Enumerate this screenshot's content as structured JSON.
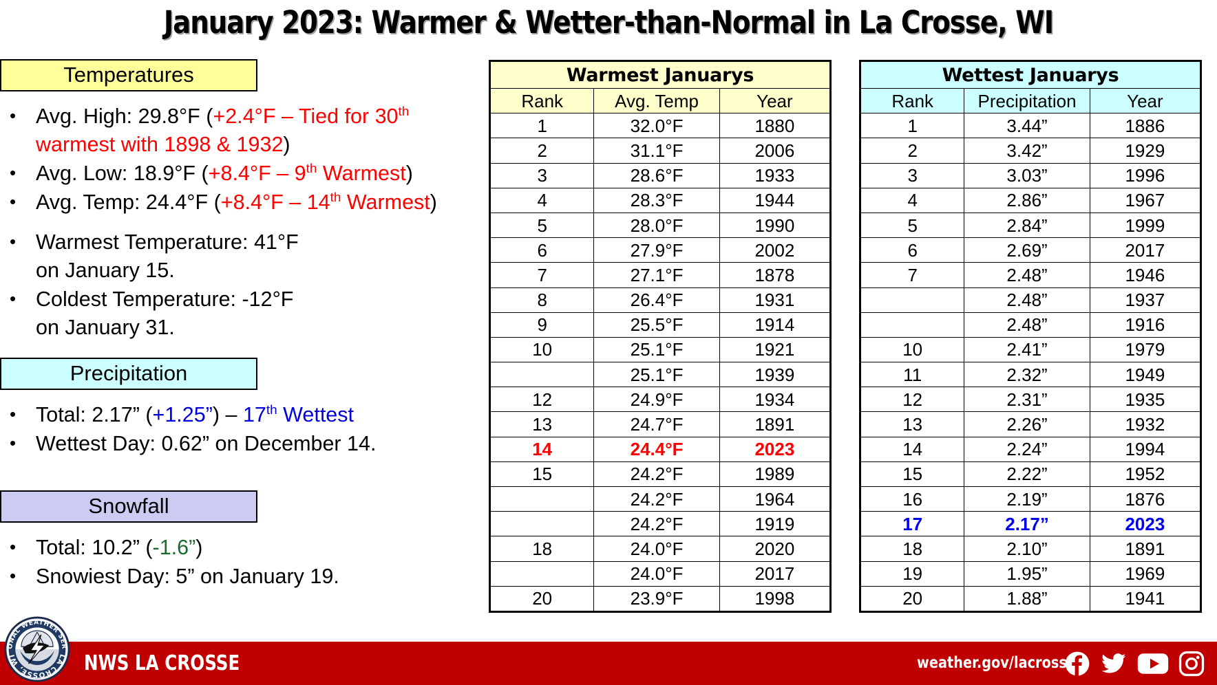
{
  "title": "January 2023: Warmer & Wetter-than-Normal in La Crosse, WI",
  "sections": {
    "temperatures": {
      "heading": "Temperatures",
      "bullets": {
        "avg_high": {
          "lead": "Avg. High:  29.8°F (",
          "accent": "+2.4°F – Tied for 30",
          "accent_sup": "th",
          "accent2": " warmest with 1898 & 1932",
          "tail": ")"
        },
        "avg_low": {
          "lead": "Avg. Low:  18.9°F (",
          "accent": "+8.4°F – 9",
          "accent_sup": "th",
          "accent2": " Warmest",
          "tail": ")"
        },
        "avg_temp": {
          "lead": "Avg. Temp:  24.4°F (",
          "accent": "+8.4°F – 14",
          "accent_sup": "th",
          "accent2": " Warmest",
          "tail": ")"
        },
        "warmest": "Warmest Temperature: 41°F on January 15.",
        "coldest": "Coldest Temperature: -12°F on January 31."
      }
    },
    "precipitation": {
      "heading": "Precipitation",
      "bullets": {
        "total": {
          "lead": "Total:  2.17” (",
          "accent": "+1.25”",
          "mid": ") – ",
          "accent2": "17",
          "accent_sup": "th",
          "accent3": " Wettest"
        },
        "wettest_day": "Wettest Day: 0.62” on December 14."
      }
    },
    "snowfall": {
      "heading": "Snowfall",
      "bullets": {
        "total": {
          "lead": "Total:  10.2” (",
          "accent": "-1.6”",
          "tail": ")"
        },
        "snowiest_day": "Snowiest Day: 5” on January 19."
      }
    }
  },
  "tables": {
    "warmest": {
      "title": "Warmest Januarys",
      "columns": [
        "Rank",
        "Avg. Temp",
        "Year"
      ],
      "rows": [
        [
          "1",
          "32.0°F",
          "1880"
        ],
        [
          "2",
          "31.1°F",
          "2006"
        ],
        [
          "3",
          "28.6°F",
          "1933"
        ],
        [
          "4",
          "28.3°F",
          "1944"
        ],
        [
          "5",
          "28.0°F",
          "1990"
        ],
        [
          "6",
          "27.9°F",
          "2002"
        ],
        [
          "7",
          "27.1°F",
          "1878"
        ],
        [
          "8",
          "26.4°F",
          "1931"
        ],
        [
          "9",
          "25.5°F",
          "1914"
        ],
        [
          "10",
          "25.1°F",
          "1921"
        ],
        [
          "",
          "25.1°F",
          "1939"
        ],
        [
          "12",
          "24.9°F",
          "1934"
        ],
        [
          "13",
          "24.7°F",
          "1891"
        ],
        [
          "14",
          "24.4°F",
          "2023"
        ],
        [
          "15",
          "24.2°F",
          "1989"
        ],
        [
          "",
          "24.2°F",
          "1964"
        ],
        [
          "",
          "24.2°F",
          "1919"
        ],
        [
          "18",
          "24.0°F",
          "2020"
        ],
        [
          "",
          "24.0°F",
          "2017"
        ],
        [
          "20",
          "23.9°F",
          "1998"
        ]
      ],
      "highlight_row_index": 13,
      "highlight_color": "#ff0000"
    },
    "wettest": {
      "title": "Wettest Januarys",
      "columns": [
        "Rank",
        "Precipitation",
        "Year"
      ],
      "rows": [
        [
          "1",
          "3.44”",
          "1886"
        ],
        [
          "2",
          "3.42”",
          "1929"
        ],
        [
          "3",
          "3.03”",
          "1996"
        ],
        [
          "4",
          "2.86”",
          "1967"
        ],
        [
          "5",
          "2.84”",
          "1999"
        ],
        [
          "6",
          "2.69”",
          "2017"
        ],
        [
          "7",
          "2.48”",
          "1946"
        ],
        [
          "",
          "2.48”",
          "1937"
        ],
        [
          "",
          "2.48”",
          "1916"
        ],
        [
          "10",
          "2.41”",
          "1979"
        ],
        [
          "11",
          "2.32”",
          "1949"
        ],
        [
          "12",
          "2.31”",
          "1935"
        ],
        [
          "13",
          "2.26”",
          "1932"
        ],
        [
          "14",
          "2.24”",
          "1994"
        ],
        [
          "15",
          "2.22”",
          "1952"
        ],
        [
          "16",
          "2.19”",
          "1876"
        ],
        [
          "17",
          "2.17”",
          "2023"
        ],
        [
          "18",
          "2.10”",
          "1891"
        ],
        [
          "19",
          "1.95”",
          "1969"
        ],
        [
          "20",
          "1.88”",
          "1941"
        ]
      ],
      "highlight_row_index": 16,
      "highlight_color": "#0000ee"
    }
  },
  "footer": {
    "office": "NWS LA CROSSE",
    "url": "weather.gov/lacrosse",
    "bar_color": "#c00000",
    "logo_text_top": "NATIONAL WEATHER SERVICE",
    "logo_text_bottom": "LA CROSSE, WI",
    "social": [
      "facebook-icon",
      "twitter-icon",
      "youtube-icon",
      "instagram-icon"
    ]
  },
  "colors": {
    "temperatures_box": "#ffff99",
    "precipitation_box": "#ccffff",
    "snowfall_box": "#ccccf2",
    "warm_header": "#ffffcc",
    "wet_header": "#ccffff",
    "accent_red": "#ff0000",
    "accent_blue": "#0000dd",
    "accent_green": "#1a6b32"
  }
}
